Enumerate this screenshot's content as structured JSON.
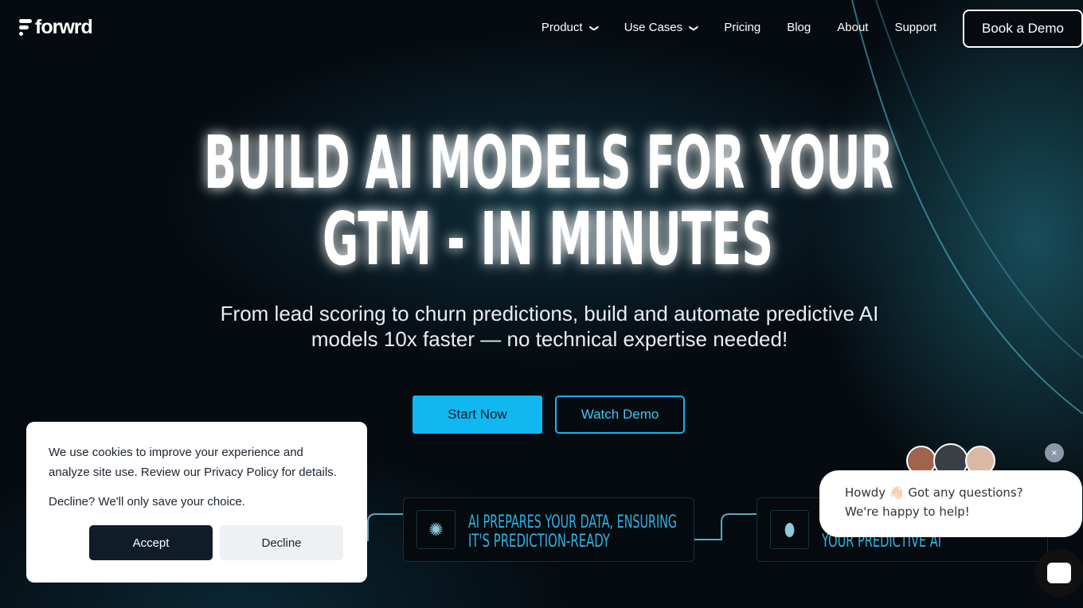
{
  "nav": {
    "logo": "forwrd",
    "items": [
      {
        "label": "Product",
        "dropdown": true
      },
      {
        "label": "Use Cases",
        "dropdown": true
      },
      {
        "label": "Pricing"
      },
      {
        "label": "Blog"
      },
      {
        "label": "About"
      },
      {
        "label": "Support"
      }
    ],
    "cta": "Book a Demo"
  },
  "hero": {
    "title_line1": "BUILD AI MODELS FOR YOUR",
    "title_line2": "GTM - IN MINUTES",
    "subtitle": "From lead scoring to churn predictions, build and automate predictive AI models 10x faster — no technical expertise needed!",
    "start": "Start Now",
    "watch": "Watch Demo"
  },
  "steps": [
    {
      "icon": "brain-icon",
      "text1": "AI PREPARES YOUR DATA, ENSURING",
      "text2": "IT'S PREDICTION-READY"
    },
    {
      "icon": "football-icon",
      "text1": "",
      "text2": "YOUR PREDICTIVE AI"
    }
  ],
  "cookie": {
    "text1": "We use cookies to improve your experience and analyze site use. Review our Privacy Policy for details.",
    "text2": "Decline? We'll only save your choice.",
    "accept": "Accept",
    "decline": "Decline"
  },
  "chat": {
    "message": "Howdy 👋🏻 Got any questions? We're happy to help!",
    "close": "×"
  },
  "colors": {
    "accent": "#11b7f0",
    "background": "#050b10"
  }
}
